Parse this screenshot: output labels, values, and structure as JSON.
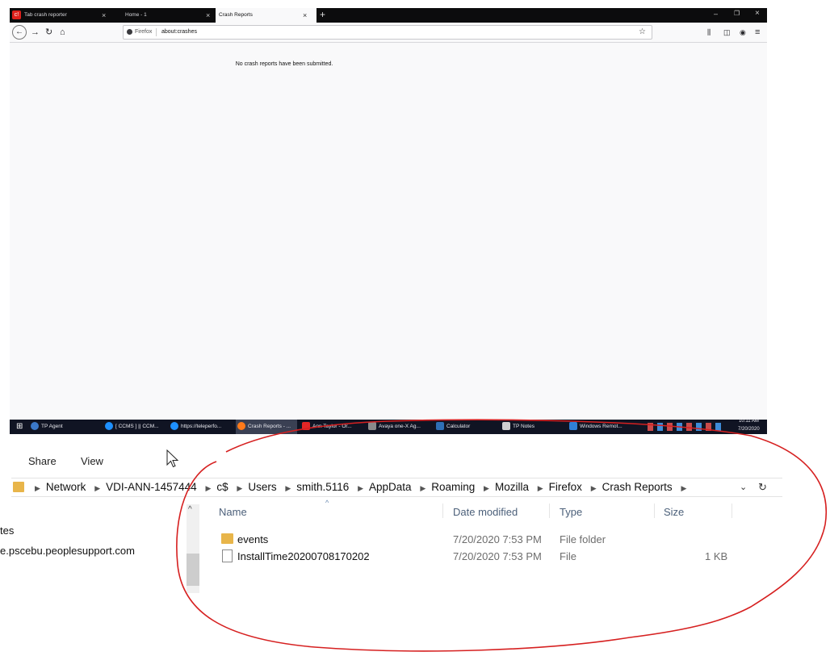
{
  "browser": {
    "tabs": [
      {
        "label": "Tab crash reporter",
        "close": "×"
      },
      {
        "label": "Home - 1",
        "close": "×"
      },
      {
        "label": "Crash Reports",
        "close": "×"
      }
    ],
    "new_tab": "+",
    "window_controls": {
      "minimize": "–",
      "restore": "❐",
      "close": "×"
    },
    "nav": {
      "back": "←",
      "forward": "→",
      "reload": "↻",
      "home": "⌂"
    },
    "identity_label": "Firefox",
    "url": "about:crashes",
    "bookmark_star": "☆",
    "toolbar_icons": {
      "library": "⫼",
      "sidebar": "◫",
      "account": "◉",
      "menu": "≡"
    },
    "page_message": "No crash reports have been submitted."
  },
  "taskbar": {
    "start": "⊞",
    "items": [
      {
        "label": "TP Agent",
        "color": "#3b78c8"
      },
      {
        "label": "[ CCMS ] || CCM...",
        "color": "#1e90ff"
      },
      {
        "label": "https://teleperfo...",
        "color": "#1e90ff"
      },
      {
        "label": "Crash Reports - ...",
        "color": "#ff7a1a"
      },
      {
        "label": "Ann Taylor - Or...",
        "color": "#e32626"
      },
      {
        "label": "Avaya one-X Ag...",
        "color": "#8a8a8a"
      },
      {
        "label": "Calculator",
        "color": "#2f6fb5"
      },
      {
        "label": "TP Notes",
        "color": "#d0d0d0"
      },
      {
        "label": "Windows Remot...",
        "color": "#2f7fd6"
      }
    ],
    "clock": {
      "time": "10:11 AM",
      "date": "7/20/2020"
    }
  },
  "explorer": {
    "ribbon_tabs": [
      "Share",
      "View"
    ],
    "breadcrumb": [
      "Network",
      "VDI-ANN-1457444",
      "c$",
      "Users",
      "smith.5116",
      "AppData",
      "Roaming",
      "Mozilla",
      "Firefox",
      "Crash Reports"
    ],
    "columns": {
      "name": "Name",
      "date": "Date modified",
      "type": "Type",
      "size": "Size"
    },
    "files": [
      {
        "name": "events",
        "date": "7/20/2020 7:53 PM",
        "type": "File folder",
        "size": ""
      },
      {
        "name": "InstallTime20200708170202",
        "date": "7/20/2020 7:53 PM",
        "type": "File",
        "size": "1 KB"
      }
    ],
    "nav_pane": [
      "tes",
      "e.pscebu.peoplesupport.com"
    ],
    "folder_color": "#e8b54a",
    "annotation_color": "#d62020"
  }
}
